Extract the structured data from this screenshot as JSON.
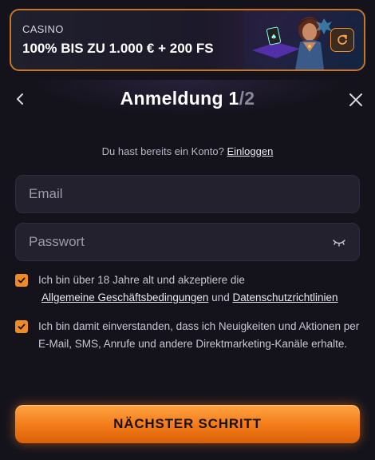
{
  "banner": {
    "category": "CASINO",
    "promo": "100% BIS ZU 1.000 € + 200 FS",
    "refresh_icon": "refresh-icon"
  },
  "header": {
    "title_main": "Anmeldung 1",
    "title_sep": "/2",
    "back_icon": "chevron-left-icon",
    "close_icon": "close-icon"
  },
  "login_prompt": {
    "text": "Du hast bereits ein Konto?",
    "link": "Einloggen"
  },
  "form": {
    "email_placeholder": "Email",
    "password_placeholder": "Passwort",
    "eye_icon": "eye-closed-icon"
  },
  "consent": {
    "age_text": "Ich bin über 18 Jahre alt und akzeptiere die",
    "terms_link": "Allgemeine Geschäftsbedingungen",
    "and": "und",
    "privacy_link": "Datenschutzrichtlinien",
    "marketing_text": "Ich bin damit einverstanden, dass ich Neuigkeiten und Aktionen per E-Mail, SMS, Anrufe und andere Direktmarketing-Kanäle erhalte."
  },
  "actions": {
    "next_label": "NÄCHSTER SCHRITT"
  },
  "colors": {
    "accent": "#f08a24",
    "background": "#14131c",
    "field": "#22212d"
  }
}
